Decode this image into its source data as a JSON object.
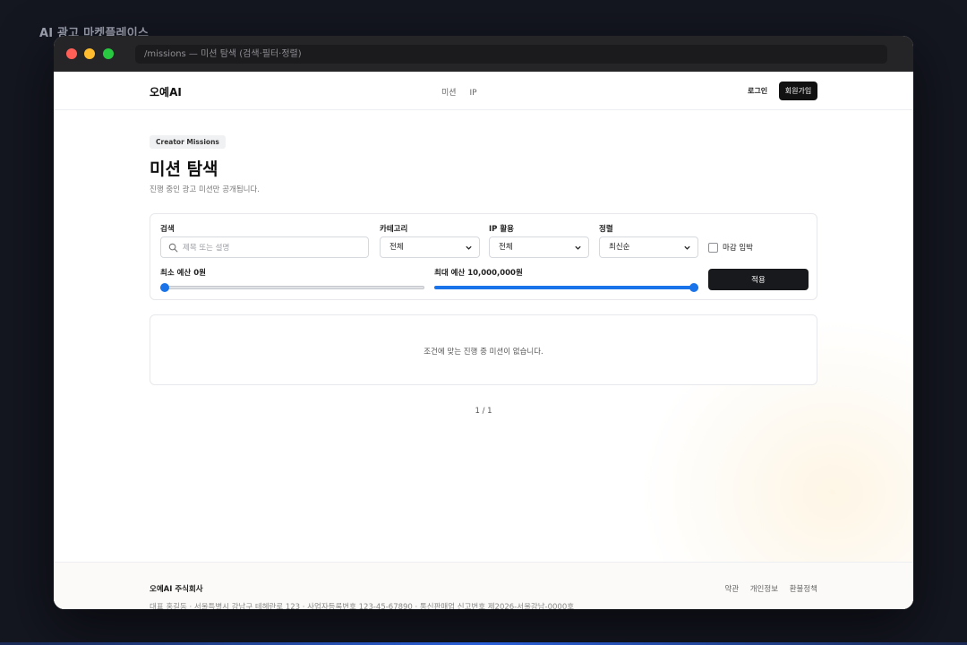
{
  "outer_caption": "AI 광고 마켓플레이스",
  "window": {
    "address": "/missions — 미션 탐색 (검색·필터·정렬)"
  },
  "nav": {
    "brand": "오예AI",
    "links": [
      "미션",
      "IP"
    ],
    "login": "로그인",
    "signup": "회원가입"
  },
  "header": {
    "badge": "Creator Missions",
    "title": "미션 탐색",
    "subtitle": "진행 중인 광고 미션만 공개됩니다."
  },
  "filters": {
    "search_label": "검색",
    "search_placeholder": "제목 또는 설명",
    "category_label": "카테고리",
    "category_value": "전체",
    "ip_label": "IP 활용",
    "ip_value": "전체",
    "sort_label": "정렬",
    "sort_value": "최신순",
    "deadline_label": "마감 임박",
    "deadline_checked": false,
    "min_budget_label": "최소 예산 0원",
    "min_budget_fraction": 0,
    "max_budget_label": "최대 예산 10,000,000원",
    "max_budget_fraction": 1,
    "apply_label": "적용"
  },
  "results": {
    "empty_message": "조건에 맞는 진행 중 미션이 없습니다.",
    "pagination": "1 / 1"
  },
  "footer": {
    "company": "오예AI 주식회사",
    "info": "대표 홍길동 · 서울특별시 강남구 테헤란로 123 · 사업자등록번호 123-45-67890 · 통신판매업 신고번호 제2026-서울강남-0000호",
    "links": [
      "약관",
      "개인정보",
      "환불정책"
    ]
  },
  "colors": {
    "accent": "#1a73e8",
    "primary_button": "#18191c"
  }
}
